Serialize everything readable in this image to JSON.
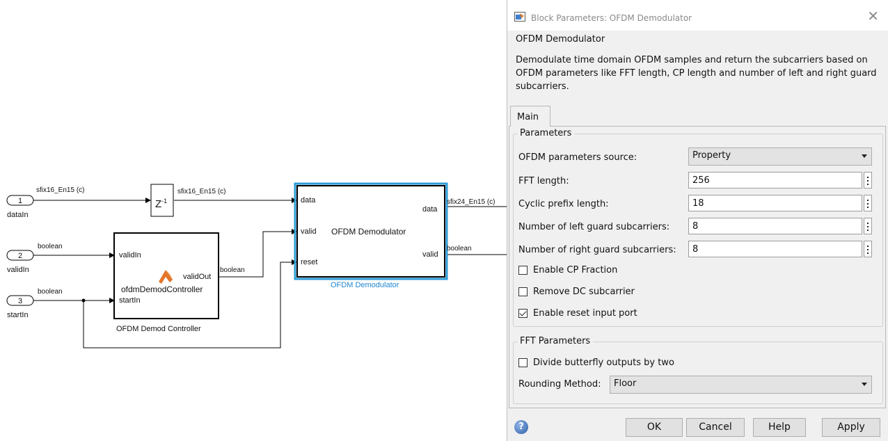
{
  "diagram": {
    "inports": [
      {
        "number": "1",
        "name": "dataIn",
        "signal": "sfix16_En15 (c)"
      },
      {
        "number": "2",
        "name": "validIn",
        "signal": "boolean"
      },
      {
        "number": "3",
        "name": "startIn",
        "signal": "boolean"
      }
    ],
    "delay": {
      "label": "Z",
      "exponent": "-1",
      "out_signal": "sfix16_En15 (c)"
    },
    "controller": {
      "inputs": [
        "validIn",
        "startIn"
      ],
      "output": "validOut",
      "function": "ofdmDemodController",
      "name": "OFDM Demod Controller",
      "out_signal": "boolean"
    },
    "demodulator": {
      "inputs": [
        "data",
        "valid",
        "reset"
      ],
      "outputs": [
        "data",
        "valid"
      ],
      "center": "OFDM Demodulator",
      "name": "OFDM Demodulator",
      "out_data_signal": "sfix24_En15 (c)",
      "out_valid_signal": "boolean"
    }
  },
  "dialog": {
    "title": "Block Parameters: OFDM Demodulator",
    "block_name": "OFDM Demodulator",
    "description": "Demodulate time domain OFDM samples and return the subcarriers based on OFDM parameters like FFT length, CP length and number of left and right guard subcarriers.",
    "tab": "Main",
    "parameters_group": "Parameters",
    "source_label": "OFDM parameters source:",
    "source_value": "Property",
    "fields": [
      {
        "label": "FFT length:",
        "value": "256"
      },
      {
        "label": "Cyclic prefix length:",
        "value": "18"
      },
      {
        "label": "Number of left guard subcarriers:",
        "value": "8"
      },
      {
        "label": "Number of right guard subcarriers:",
        "value": "8"
      }
    ],
    "checkboxes": [
      {
        "label": "Enable CP Fraction",
        "checked": false
      },
      {
        "label": "Remove DC subcarrier",
        "checked": false
      },
      {
        "label": "Enable reset input port",
        "checked": true
      }
    ],
    "fft_group": "FFT Parameters",
    "divide_label": "Divide butterfly outputs by two",
    "divide_checked": false,
    "rounding_label": "Rounding Method:",
    "rounding_value": "Floor",
    "buttons": {
      "ok": "OK",
      "cancel": "Cancel",
      "help": "Help",
      "apply": "Apply"
    },
    "help_icon_text": "?"
  },
  "colors": {
    "selection": "#2e9bd6",
    "block_name_selected": "#1f86cf"
  }
}
